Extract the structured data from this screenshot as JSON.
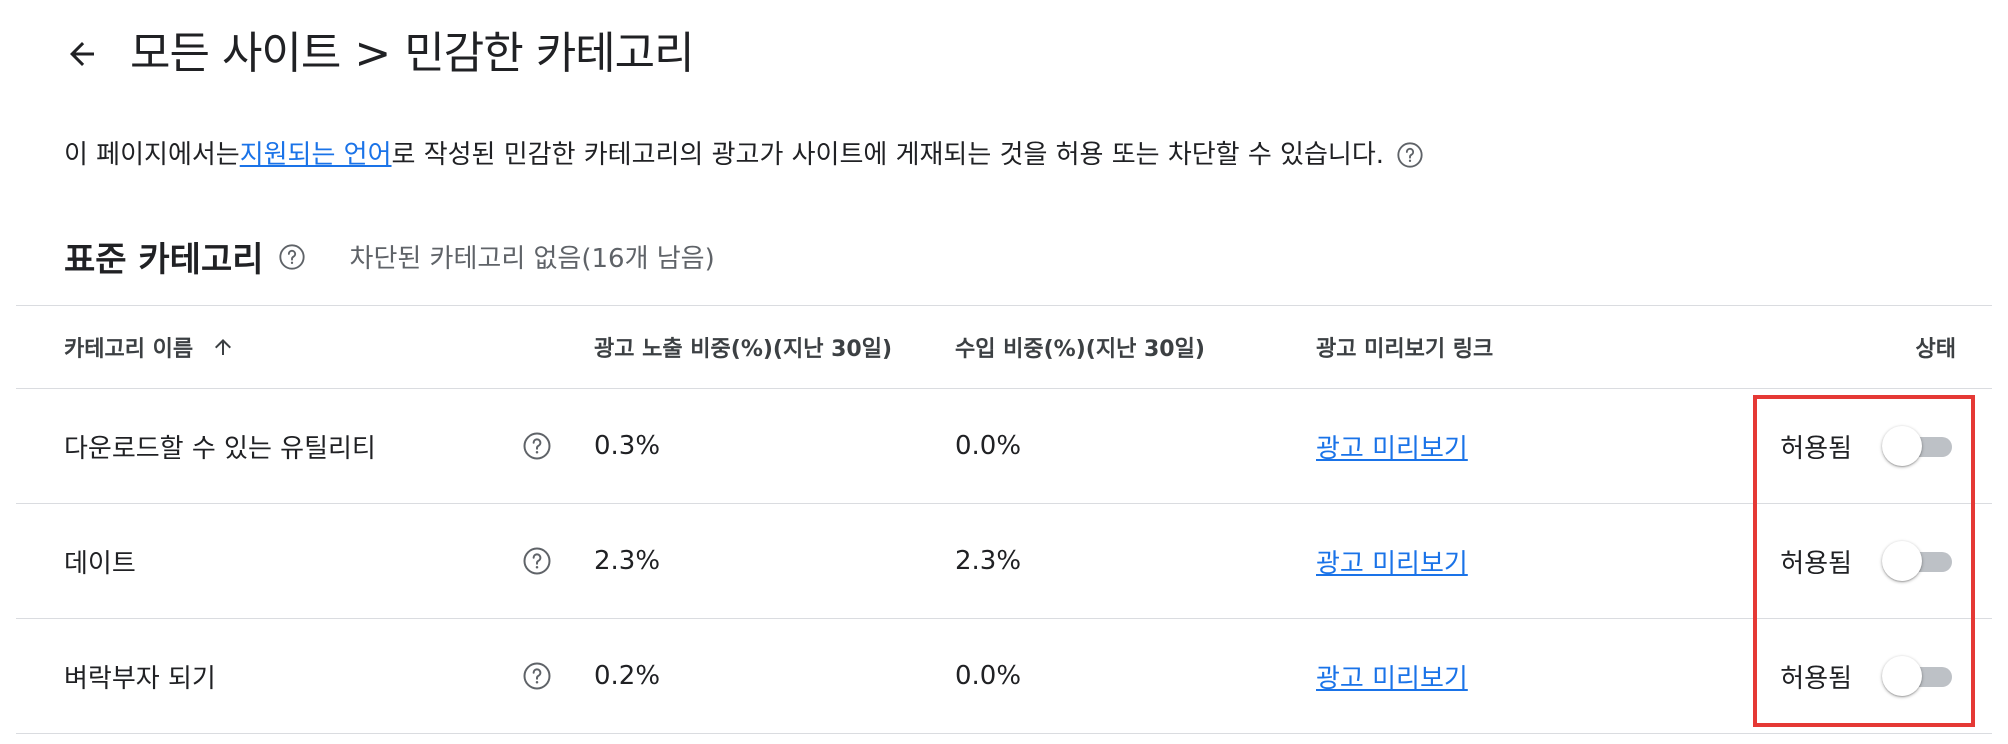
{
  "header": {
    "back_icon": "arrow-back-icon",
    "crumb_all_sites": "모든 사이트",
    "crumb_separator": ">",
    "crumb_current": "민감한 카테고리"
  },
  "description": {
    "prefix": "이 페이지에서는 ",
    "link": "지원되는 언어",
    "suffix": "로 작성된 민감한 카테고리의 광고가 사이트에 게재되는 것을 허용 또는 차단할 수 있습니다.",
    "help_icon": "help-circle-icon"
  },
  "section": {
    "title": "표준 카테고리",
    "summary": "차단된 카테고리 없음(16개 남음)"
  },
  "table": {
    "headers": {
      "name": "카테고리 이름",
      "impressions": "광고 노출 비중(%)(지난 30일)",
      "revenue": "수입 비중(%)(지난 30일)",
      "preview": "광고 미리보기 링크",
      "status": "상태"
    },
    "sort_icon": "arrow-upward-icon",
    "rows": [
      {
        "name": "다운로드할 수 있는 유틸리티",
        "impressions": "0.3%",
        "revenue": "0.0%",
        "preview": "광고 미리보기",
        "status": "허용됨",
        "enabled": false
      },
      {
        "name": "데이트",
        "impressions": "2.3%",
        "revenue": "2.3%",
        "preview": "광고 미리보기",
        "status": "허용됨",
        "enabled": false
      },
      {
        "name": "벼락부자 되기",
        "impressions": "0.2%",
        "revenue": "0.0%",
        "preview": "광고 미리보기",
        "status": "허용됨",
        "enabled": false
      }
    ]
  },
  "colors": {
    "link": "#1a73e8",
    "highlight": "#e53935",
    "toggle_track": "#bdc1c6"
  }
}
